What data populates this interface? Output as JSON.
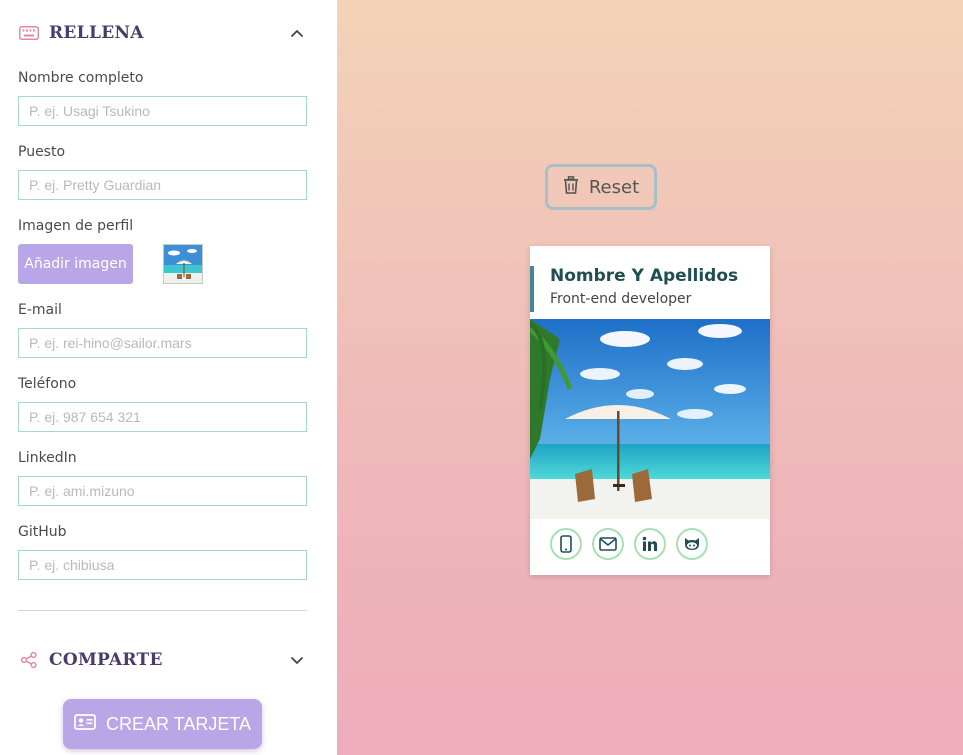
{
  "form": {
    "fill_section": {
      "title": "RELLENA",
      "icon": "keyboard-icon"
    },
    "fields": [
      {
        "label": "Nombre completo",
        "placeholder": "P. ej. Usagi Tsukino"
      },
      {
        "label": "Puesto",
        "placeholder": "P. ej. Pretty Guardian"
      },
      {
        "label": "Imagen de perfil"
      },
      {
        "label": "E-mail",
        "placeholder": "P. ej. rei-hino@sailor.mars"
      },
      {
        "label": "Teléfono",
        "placeholder": "P. ej. 987 654 321"
      },
      {
        "label": "LinkedIn",
        "placeholder": "P. ej. ami.mizuno"
      },
      {
        "label": "GitHub",
        "placeholder": "P. ej. chibiusa"
      }
    ],
    "add_image_label": "Añadir imagen",
    "share_section": {
      "title": "COMPARTE",
      "icon": "share-icon"
    },
    "create_button_label": "CREAR TARJETA"
  },
  "preview": {
    "reset_label": "Reset",
    "card": {
      "name": "Nombre Y Apellidos",
      "job": "Front-end developer",
      "socials": [
        "phone-icon",
        "mail-icon",
        "linkedin-icon",
        "github-icon"
      ]
    }
  },
  "colors": {
    "accent": "#b8a6e6",
    "title": "#4b3b6b",
    "input_border": "#a7d6d0",
    "card_name": "#1f4f53",
    "card_border": "#438792",
    "social_border": "#a6e0b4",
    "gradient_top": "#f3d3b8",
    "gradient_bottom": "#eeacbc"
  }
}
